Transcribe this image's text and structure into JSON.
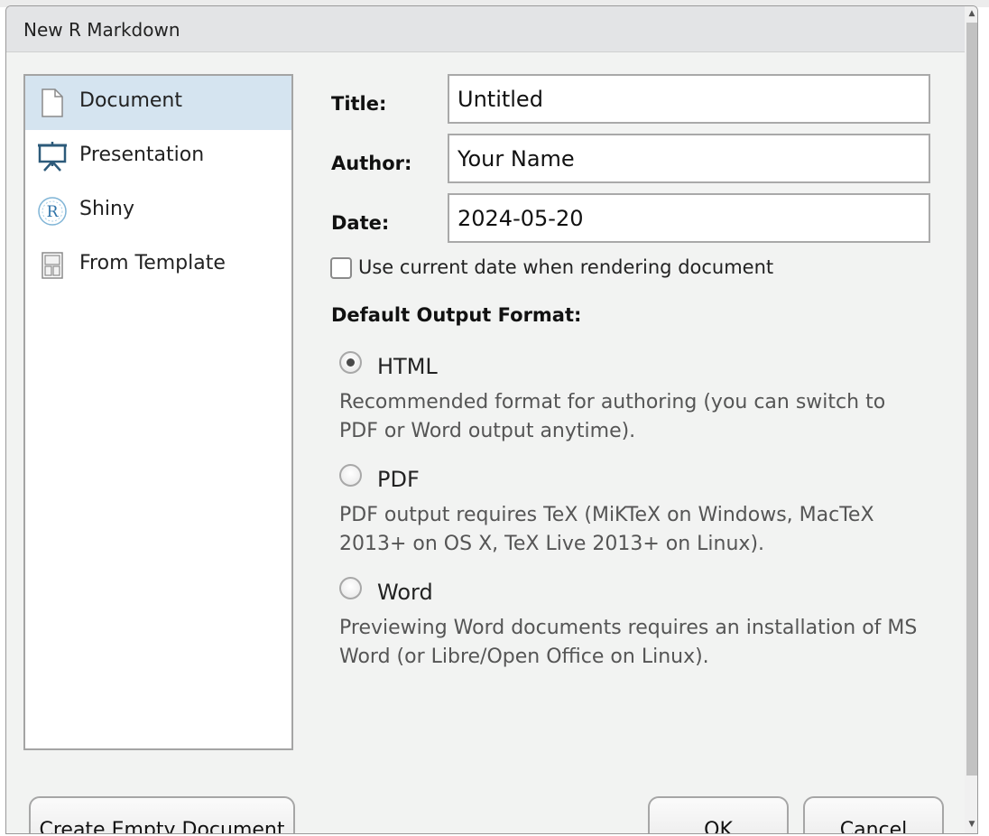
{
  "dialog": {
    "title": "New R Markdown"
  },
  "sidebar": {
    "items": [
      {
        "label": "Document",
        "icon": "document-icon",
        "selected": true
      },
      {
        "label": "Presentation",
        "icon": "presentation-icon",
        "selected": false
      },
      {
        "label": "Shiny",
        "icon": "shiny-icon",
        "selected": false
      },
      {
        "label": "From Template",
        "icon": "template-icon",
        "selected": false
      }
    ]
  },
  "form": {
    "title_label": "Title:",
    "title_value": "Untitled",
    "author_label": "Author:",
    "author_value": "Your Name",
    "date_label": "Date:",
    "date_value": "2024-05-20",
    "use_current_date_label": "Use current date when rendering document",
    "use_current_date_checked": false
  },
  "output_format": {
    "heading": "Default Output Format:",
    "options": [
      {
        "label": "HTML",
        "selected": true,
        "description": "Recommended format for authoring (you can switch to PDF or Word output anytime)."
      },
      {
        "label": "PDF",
        "selected": false,
        "description": "PDF output requires TeX (MiKTeX on Windows, MacTeX 2013+ on OS X, TeX Live 2013+ on Linux)."
      },
      {
        "label": "Word",
        "selected": false,
        "description": "Previewing Word documents requires an installation of MS Word (or Libre/Open Office on Linux)."
      }
    ]
  },
  "buttons": {
    "create_empty": "Create Empty Document",
    "ok": "OK",
    "cancel": "Cancel"
  },
  "colors": {
    "selected_bg": "#d5e4f0",
    "dialog_bg": "#f2f3f2",
    "titlebar_bg": "#e3e4e6"
  }
}
